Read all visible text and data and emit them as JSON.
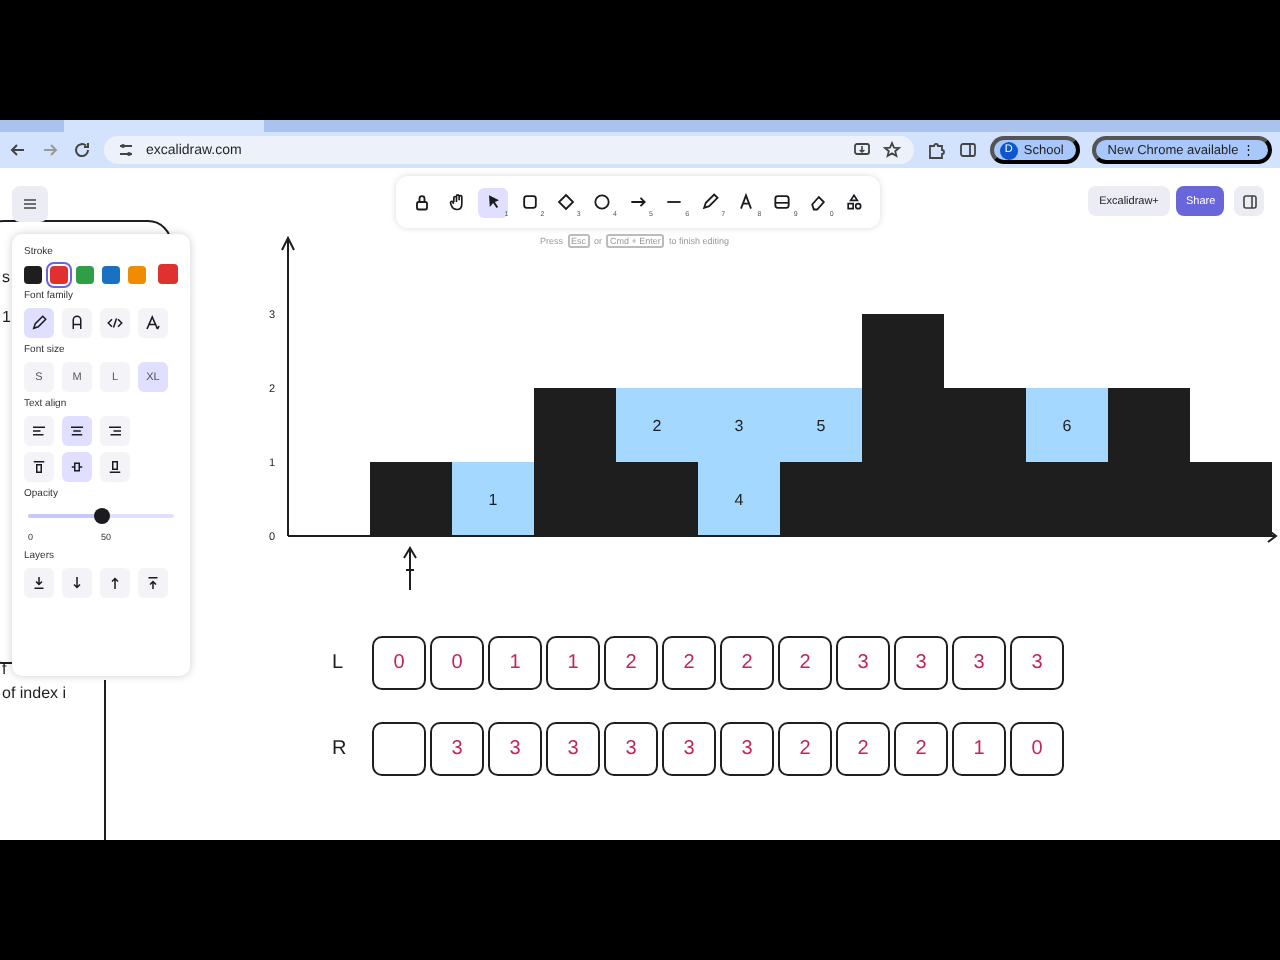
{
  "browser": {
    "url": "excalidraw.com",
    "profile": {
      "initial": "D",
      "name": "School"
    },
    "update": {
      "label": "New Chrome available",
      "menu_glyph": "⋮"
    }
  },
  "toolbar": {
    "tools": [
      {
        "kind": "lock",
        "selected": false
      },
      {
        "kind": "hand",
        "selected": false
      },
      {
        "kind": "selection",
        "shortcut": "1",
        "selected": true
      },
      {
        "kind": "rectangle",
        "shortcut": "2",
        "selected": false
      },
      {
        "kind": "diamond",
        "shortcut": "3",
        "selected": false
      },
      {
        "kind": "ellipse",
        "shortcut": "4",
        "selected": false
      },
      {
        "kind": "arrow",
        "shortcut": "5",
        "selected": false
      },
      {
        "kind": "line",
        "shortcut": "6",
        "selected": false
      },
      {
        "kind": "pencil",
        "shortcut": "7",
        "selected": false
      },
      {
        "kind": "text",
        "shortcut": "8",
        "selected": false
      },
      {
        "kind": "image",
        "shortcut": "9",
        "selected": false
      },
      {
        "kind": "eraser",
        "shortcut": "0",
        "selected": false
      },
      {
        "kind": "shapes",
        "selected": false
      }
    ]
  },
  "hint": [
    {
      "kind": "text",
      "text": "Press"
    },
    {
      "kind": "key",
      "text": "Esc"
    },
    {
      "kind": "text",
      "text": "or"
    },
    {
      "kind": "key",
      "text": "Cmd + Enter"
    },
    {
      "kind": "text",
      "text": "to finish editing"
    }
  ],
  "header": {
    "plus_button": "Excalidraw+",
    "share_button": "Share"
  },
  "properties": {
    "stroke": {
      "label": "Stroke",
      "swatches": [
        {
          "color": "#1e1e1e",
          "selected": false
        },
        {
          "color": "#e03131",
          "selected": true
        },
        {
          "color": "#2f9e44",
          "selected": false
        },
        {
          "color": "#1971c2",
          "selected": false
        },
        {
          "color": "#f08c00",
          "selected": false
        }
      ],
      "current": {
        "color": "#e03131"
      }
    },
    "font_family": {
      "label": "Font family",
      "options": [
        {
          "kind": "handdrawn",
          "selected": true
        },
        {
          "kind": "normal",
          "selected": false
        },
        {
          "kind": "code",
          "selected": false
        },
        {
          "kind": "more",
          "selected": false
        }
      ]
    },
    "font_size": {
      "label": "Font size",
      "options": [
        {
          "label": "S",
          "selected": false
        },
        {
          "label": "M",
          "selected": false
        },
        {
          "label": "L",
          "selected": false
        },
        {
          "label": "XL",
          "selected": true
        }
      ]
    },
    "text_align": {
      "label": "Text align",
      "options": [
        {
          "kind": "left",
          "selected": false
        },
        {
          "kind": "center",
          "selected": true
        },
        {
          "kind": "right",
          "selected": false
        }
      ]
    },
    "vertical_align": {
      "options": [
        {
          "kind": "top",
          "selected": false
        },
        {
          "kind": "middle",
          "selected": true
        },
        {
          "kind": "bottom",
          "selected": false
        }
      ]
    },
    "opacity": {
      "label": "Opacity",
      "level": 0.5,
      "min_label": "0",
      "value_label": "50"
    },
    "layers": {
      "label": "Layers",
      "actions": [
        {
          "kind": "to_back"
        },
        {
          "kind": "backward"
        },
        {
          "kind": "forward"
        },
        {
          "kind": "to_front"
        }
      ]
    }
  },
  "canvas": {
    "side_texts": [
      "s",
      "1",
      "f",
      "of index i"
    ],
    "chart_data": {
      "type": "bar",
      "stacked": true,
      "ylim": [
        0,
        4
      ],
      "yticks": [
        0,
        1,
        2,
        3
      ],
      "series": [
        {
          "color": "#1e1e1e",
          "values": [
            0,
            1,
            0,
            2,
            1,
            0,
            1,
            3,
            2,
            1,
            2,
            1
          ]
        },
        {
          "color": "#a5d8ff",
          "values": [
            0,
            0,
            1,
            0,
            1,
            2,
            1,
            0,
            0,
            1,
            0,
            0
          ]
        }
      ],
      "annotations": [
        "1",
        "2",
        "3",
        "4",
        "5",
        "6"
      ]
    },
    "arrays": [
      {
        "label": "L",
        "cells": [
          "0",
          "0",
          "1",
          "1",
          "2",
          "2",
          "2",
          "2",
          "3",
          "3",
          "3",
          "3"
        ]
      },
      {
        "label": "R",
        "cells": [
          null,
          "3",
          "3",
          "3",
          "3",
          "3",
          "3",
          "2",
          "2",
          "2",
          "1",
          "0"
        ]
      }
    ]
  }
}
